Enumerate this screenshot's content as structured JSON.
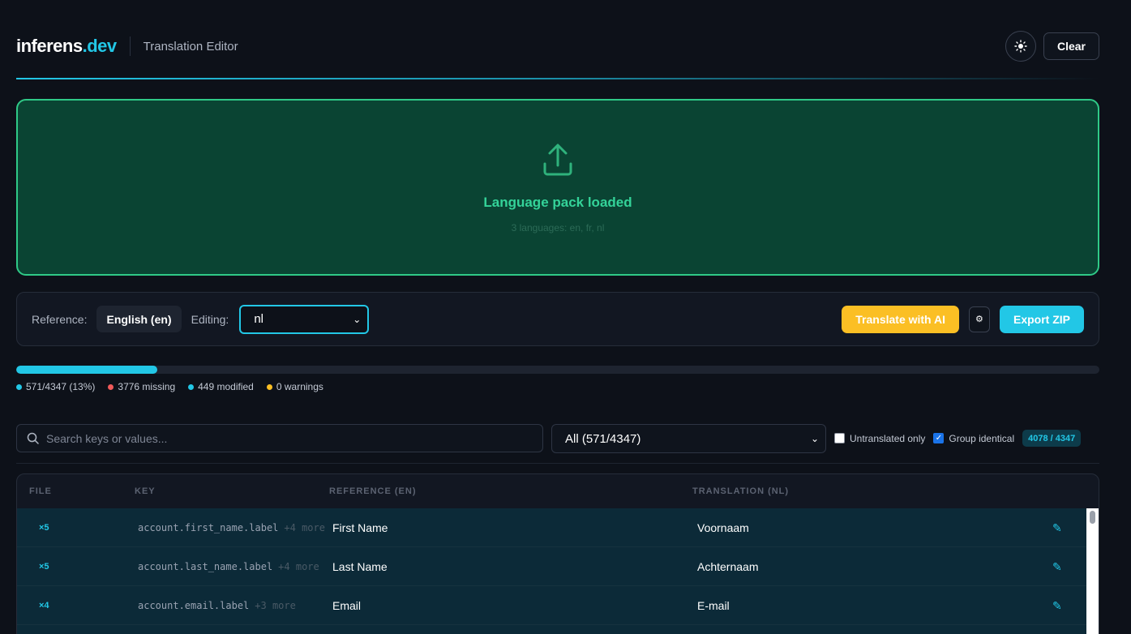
{
  "header": {
    "brand_main": "inferens",
    "brand_accent": ".dev",
    "subtitle": "Translation Editor",
    "theme_icon": "sun-icon",
    "clear_label": "Clear"
  },
  "dropzone": {
    "icon": "upload-icon",
    "title": "Language pack loaded",
    "subtitle": "3 languages: en, fr, nl"
  },
  "toolbar": {
    "reference_label": "Reference:",
    "reference_value": "English (en)",
    "editing_label": "Editing:",
    "editing_value": "nl",
    "translate_ai_label": "Translate with AI",
    "settings_icon": "gear-icon",
    "export_label": "Export ZIP"
  },
  "progress": {
    "fraction": 0.13,
    "stats": {
      "translated": "571/4347 (13%)",
      "missing": "3776 missing",
      "modified": "449 modified",
      "warnings": "0 warnings"
    }
  },
  "filters": {
    "search_placeholder": "Search keys or values...",
    "filter_value": "All (571/4347)",
    "untranslated_only_label": "Untranslated only",
    "untranslated_only_checked": false,
    "group_identical_label": "Group identical",
    "group_identical_checked": true,
    "count_badge": "4078 / 4347"
  },
  "table": {
    "columns": {
      "file": "FILE",
      "key": "KEY",
      "reference": "REFERENCE (EN)",
      "translation": "TRANSLATION (NL)"
    },
    "rows": [
      {
        "file": "×5",
        "key": "account.first_name.label",
        "more": "+4 more",
        "reference": "First Name",
        "translation": "Voornaam",
        "edit_icon": "pencil-icon"
      },
      {
        "file": "×5",
        "key": "account.last_name.label",
        "more": "+4 more",
        "reference": "Last Name",
        "translation": "Achternaam",
        "edit_icon": "pencil-icon"
      },
      {
        "file": "×4",
        "key": "account.email.label",
        "more": "+3 more",
        "reference": "Email",
        "translation": "E-mail",
        "edit_icon": "pencil-icon"
      }
    ]
  },
  "colors": {
    "accent": "#22c7e6",
    "success": "#34d399",
    "warning": "#fbbf24",
    "danger": "#f05a5a"
  }
}
